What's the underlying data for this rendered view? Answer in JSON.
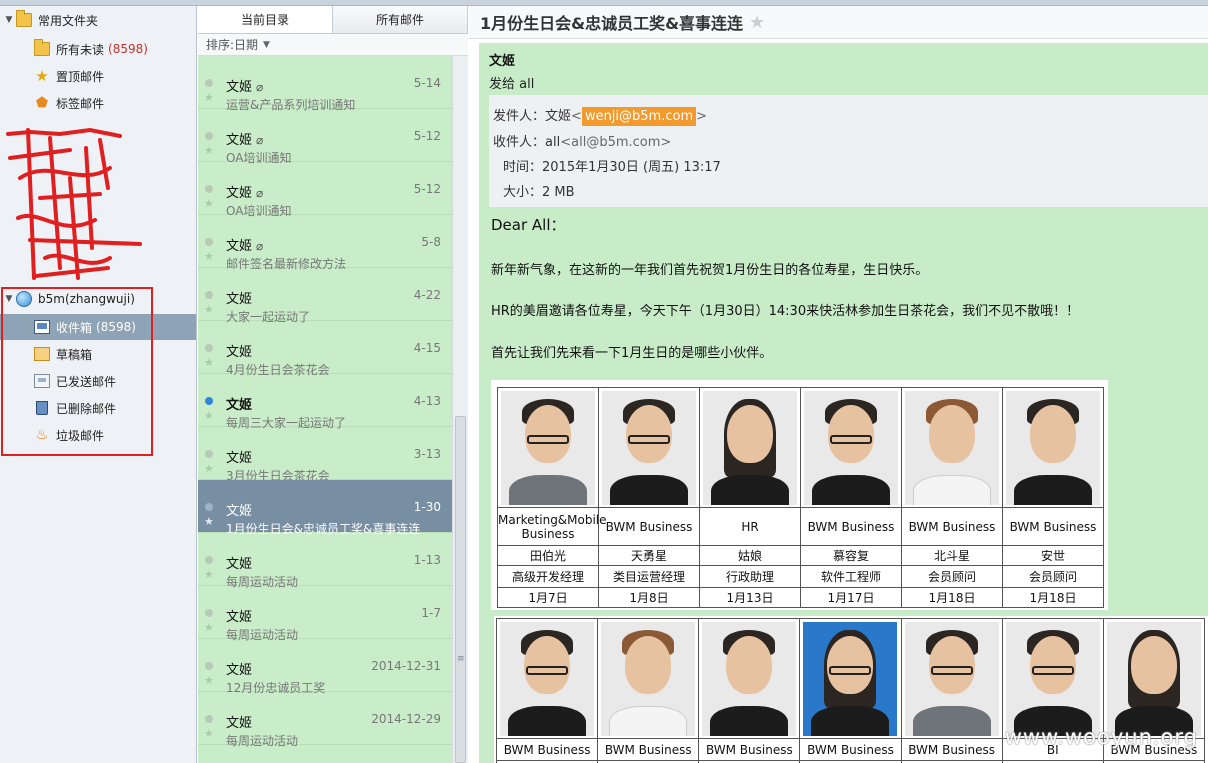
{
  "folders": {
    "common": {
      "label": "常用文件夹",
      "all_unread": {
        "label": "所有未读",
        "count": "(8598)"
      },
      "pinned": {
        "label": "置顶邮件"
      },
      "tagged": {
        "label": "标签邮件"
      }
    },
    "account": {
      "label": "b5m(zhangwuji)",
      "inbox": {
        "label": "收件箱",
        "count": "(8598)"
      },
      "drafts": {
        "label": "草稿箱"
      },
      "sent": {
        "label": "已发送邮件"
      },
      "deleted": {
        "label": "已删除邮件"
      },
      "spam": {
        "label": "垃圾邮件"
      }
    }
  },
  "list": {
    "tabs": [
      "当前目录",
      "所有邮件"
    ],
    "sort_label": "排序:日期",
    "messages": [
      {
        "from": "文姬",
        "date": "5-14",
        "subject": "运营&产品系列培训通知",
        "attachment": true,
        "unread": false,
        "selected": false
      },
      {
        "from": "文姬",
        "date": "5-12",
        "subject": "OA培训通知",
        "attachment": true,
        "unread": false,
        "selected": false
      },
      {
        "from": "文姬",
        "date": "5-12",
        "subject": "OA培训通知",
        "attachment": true,
        "unread": false,
        "selected": false
      },
      {
        "from": "文姬",
        "date": "5-8",
        "subject": "邮件签名最新修改方法",
        "attachment": true,
        "unread": false,
        "selected": false
      },
      {
        "from": "文姬",
        "date": "4-22",
        "subject": "大家一起运动了",
        "attachment": false,
        "unread": false,
        "selected": false
      },
      {
        "from": "文姬",
        "date": "4-15",
        "subject": "4月份生日会茶花会",
        "attachment": false,
        "unread": false,
        "selected": false
      },
      {
        "from": "文姬",
        "date": "4-13",
        "subject": "每周三大家一起运动了",
        "attachment": false,
        "unread": true,
        "selected": false
      },
      {
        "from": "文姬",
        "date": "3-13",
        "subject": "3月份生日会茶花会",
        "attachment": false,
        "unread": false,
        "selected": false
      },
      {
        "from": "文姬",
        "date": "1-30",
        "subject": "1月份生日会&忠诚员工奖&喜事连连",
        "attachment": false,
        "unread": false,
        "selected": true
      },
      {
        "from": "文姬",
        "date": "1-13",
        "subject": "每周运动活动",
        "attachment": false,
        "unread": false,
        "selected": false
      },
      {
        "from": "文姬",
        "date": "1-7",
        "subject": "每周运动活动",
        "attachment": false,
        "unread": false,
        "selected": false
      },
      {
        "from": "文姬",
        "date": "2014-12-31",
        "subject": "12月份忠诚员工奖",
        "attachment": false,
        "unread": false,
        "selected": false
      },
      {
        "from": "文姬",
        "date": "2014-12-29",
        "subject": "每周运动活动",
        "attachment": false,
        "unread": false,
        "selected": false
      }
    ]
  },
  "mail": {
    "title": "1月份生日会&忠诚员工奖&喜事连连",
    "sender_name": "文姬",
    "sent_to": "发给 all",
    "from_label": "发件人：",
    "from_name": "文姬",
    "from_email": "wenji@b5m.com",
    "to_label": "收件人：",
    "to_name": "all",
    "to_email": "all@b5m.com",
    "time_label": "时间：",
    "time_value": "2015年1月30日 (周五) 13:17",
    "size_label": "大小：",
    "size_value": "2 MB",
    "greeting": "Dear All：",
    "paragraphs": [
      "新年新气象，在这新的一年我们首先祝贺1月份生日的各位寿星，生日快乐。",
      "HR的美眉邀请各位寿星，今天下午（1月30日）14:30来快活林参加生日茶花会，我们不见不散哦！！",
      "首先让我们先来看一下1月生日的是哪些小伙伴。"
    ],
    "staff_row1": [
      {
        "dept": "Marketing&Mobile  Business",
        "name": "田伯光",
        "title": "高级开发经理",
        "birthday": "1月7日"
      },
      {
        "dept": "BWM Business",
        "name": "天勇星",
        "title": "类目运营经理",
        "birthday": "1月8日"
      },
      {
        "dept": "HR",
        "name": "姑娘",
        "title": "行政助理",
        "birthday": "1月13日"
      },
      {
        "dept": "BWM Business",
        "name": "慕容复",
        "title": "软件工程师",
        "birthday": "1月17日"
      },
      {
        "dept": "BWM Business",
        "name": "北斗星",
        "title": "会员顾问",
        "birthday": "1月18日"
      },
      {
        "dept": "BWM Business",
        "name": "安世",
        "title": "会员顾问",
        "birthday": "1月18日"
      }
    ],
    "staff_row2": [
      {
        "dept": "BWM Business"
      },
      {
        "dept": "BWM Business"
      },
      {
        "dept": "BWM Business"
      },
      {
        "dept": "BWM Business"
      },
      {
        "dept": "BWM Business"
      },
      {
        "dept": "BI"
      },
      {
        "dept": "BWM Business"
      }
    ]
  },
  "watermark": "www.wooyun.org",
  "colors": {
    "list_bg": "#c9ecc9",
    "selected_row": "#778ea3",
    "unread_dot": "#2f86da",
    "email_highlight": "#f29a2e",
    "annotation_red": "#e02020"
  }
}
